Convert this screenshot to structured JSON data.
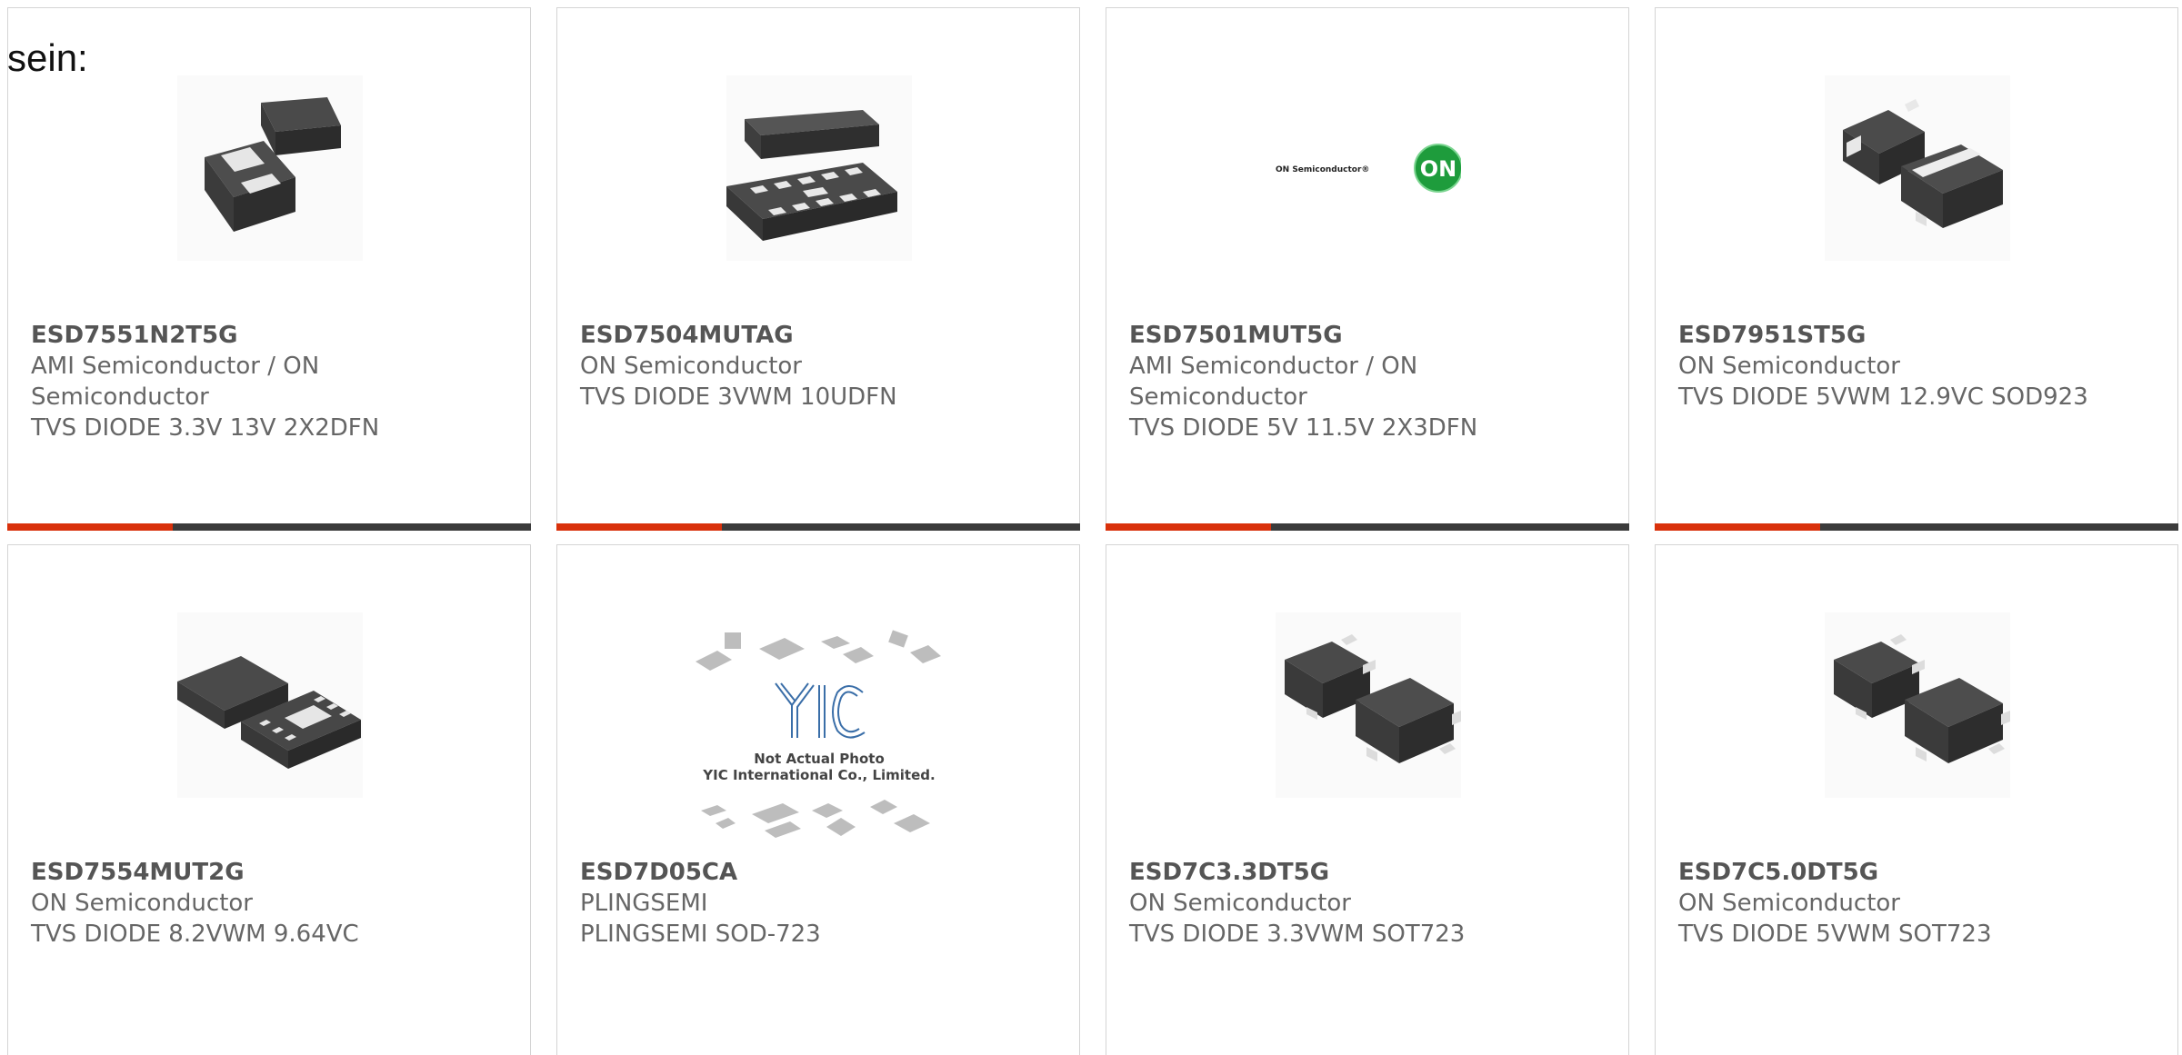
{
  "intro_text": "sein:",
  "colors": {
    "accent": "#d9310b",
    "bar": "#3b3b3b",
    "border": "#d4d4d4",
    "text": "#666666"
  },
  "products": [
    {
      "part": "ESD7551N2T5G",
      "manufacturer": "AMI Semiconductor / ON Semiconductor",
      "description": "TVS DIODE 3.3V 13V 2X2DFN",
      "image": "dfn-2-chip-icon"
    },
    {
      "part": "ESD7504MUTAG",
      "manufacturer": "ON Semiconductor",
      "description": "TVS DIODE 3VWM 10UDFN",
      "image": "udfn-10-chip-icon"
    },
    {
      "part": "ESD7501MUT5G",
      "manufacturer": "AMI Semiconductor / ON Semiconductor",
      "description": "TVS DIODE 5V 11.5V 2X3DFN",
      "image": "on-semiconductor-logo",
      "logo_text": "ON Semiconductor®",
      "logo_badge": "ON"
    },
    {
      "part": "ESD7951ST5G",
      "manufacturer": "ON Semiconductor",
      "description": "TVS DIODE 5VWM 12.9VC SOD923",
      "image": "sod923-chip-icon"
    },
    {
      "part": "ESD7554MUT2G",
      "manufacturer": "ON Semiconductor",
      "description": "TVS DIODE 8.2VWM 9.64VC",
      "image": "dfn-6-chip-icon"
    },
    {
      "part": "ESD7D05CA",
      "manufacturer": "PLINGSEMI",
      "description": "PLINGSEMI SOD-723",
      "image": "not-actual-photo-placeholder",
      "placeholder_line1": "Not Actual Photo",
      "placeholder_line2": "YIC International Co., Limited.",
      "placeholder_logo": "YIC"
    },
    {
      "part": "ESD7C3.3DT5G",
      "manufacturer": "ON Semiconductor",
      "description": "TVS DIODE 3.3VWM SOT723",
      "image": "sot723-chip-icon"
    },
    {
      "part": "ESD7C5.0DT5G",
      "manufacturer": "ON Semiconductor",
      "description": "TVS DIODE 5VWM SOT723",
      "image": "sot723-chip-icon"
    }
  ]
}
